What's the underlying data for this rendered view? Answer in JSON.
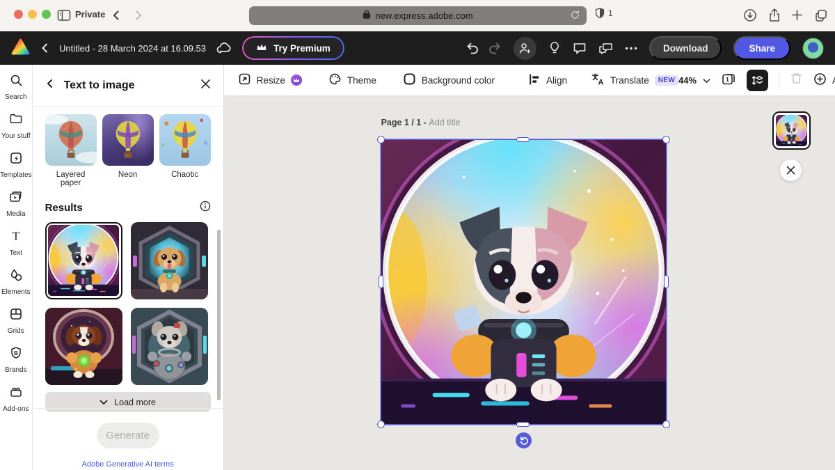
{
  "browser": {
    "private_label": "Private",
    "url": "new.express.adobe.com",
    "content_blocker_count": "1"
  },
  "header": {
    "doc_title": "Untitled - 28 March 2024 at 16.09.53",
    "try_premium_label": "Try Premium",
    "download_label": "Download",
    "share_label": "Share"
  },
  "rail": {
    "items": [
      {
        "label": "Search",
        "icon": "search-icon"
      },
      {
        "label": "Your stuff",
        "icon": "folder-icon"
      },
      {
        "label": "Templates",
        "icon": "template-icon"
      },
      {
        "label": "Media",
        "icon": "media-icon"
      },
      {
        "label": "Text",
        "icon": "text-icon"
      },
      {
        "label": "Elements",
        "icon": "shapes-icon"
      },
      {
        "label": "Grids",
        "icon": "grid-icon"
      },
      {
        "label": "Brands",
        "icon": "brand-shield-icon"
      },
      {
        "label": "Add-ons",
        "icon": "addon-brick-icon"
      }
    ]
  },
  "panel": {
    "title": "Text to image",
    "styles": [
      {
        "label": "Layered paper",
        "image": "hot-air-balloon-layered-paper"
      },
      {
        "label": "Neon",
        "image": "hot-air-balloon-neon"
      },
      {
        "label": "Chaotic",
        "image": "hot-air-balloon-chaotic"
      }
    ],
    "results_title": "Results",
    "results": [
      {
        "image": "puppy-astronaut-bubble-porthole",
        "selected": true
      },
      {
        "image": "golden-puppy-spaceship-corridor",
        "selected": false
      },
      {
        "image": "brown-puppy-orange-spacesuit",
        "selected": false
      },
      {
        "image": "gray-puppy-metallic-spacesuit",
        "selected": false
      }
    ],
    "load_more_label": "Load more",
    "generate_label": "Generate",
    "terms_link": "Adobe Generative AI terms"
  },
  "toolbar": {
    "resize_label": "Resize",
    "theme_label": "Theme",
    "background_color_label": "Background color",
    "align_label": "Align",
    "translate_label": "Translate",
    "new_badge": "NEW",
    "zoom_level": "44%",
    "add_label": "Add"
  },
  "canvas": {
    "page_indicator": "Page 1 / 1 -",
    "add_title_placeholder": "Add title"
  },
  "colors": {
    "accent_purple": "#5258e4",
    "selection_blue": "#5456d5",
    "header_bg": "#1e1e1e"
  }
}
